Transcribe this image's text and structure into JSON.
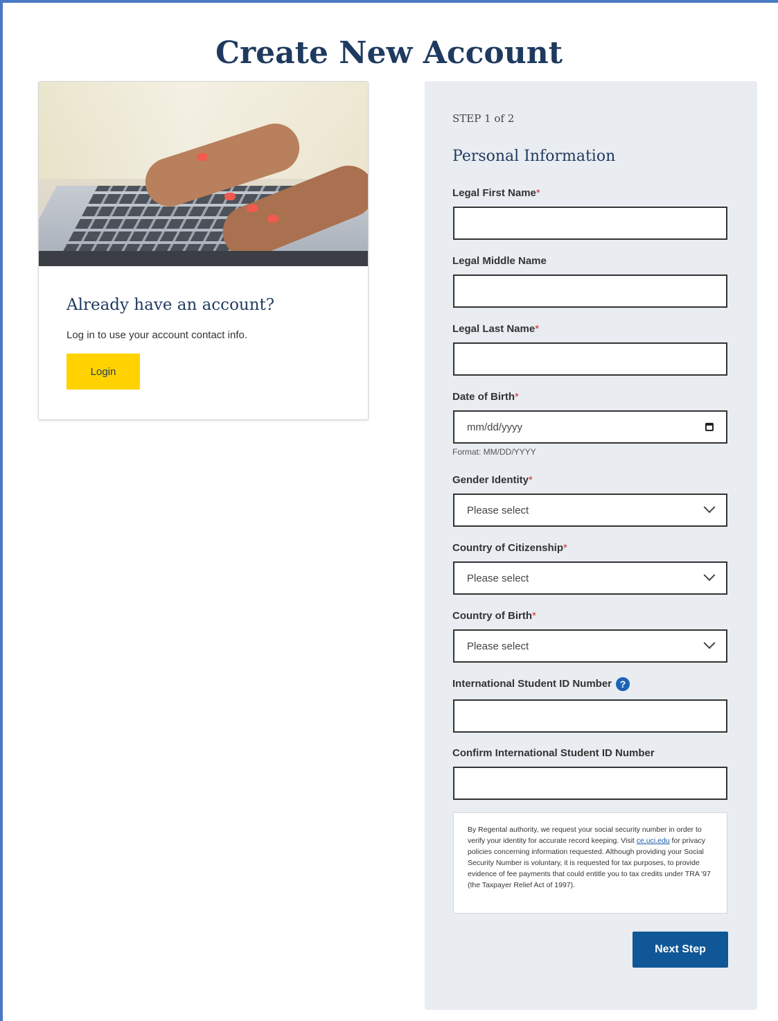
{
  "page": {
    "title": "Create New Account"
  },
  "login_card": {
    "heading": "Already have an account?",
    "text": "Log in to use your account contact info.",
    "button_label": "Login"
  },
  "form": {
    "step": "STEP 1 of 2",
    "section_title": "Personal Information",
    "fields": {
      "first_name": {
        "label": "Legal First Name",
        "required_mark": "*",
        "value": ""
      },
      "middle_name": {
        "label": "Legal Middle Name",
        "value": ""
      },
      "last_name": {
        "label": "Legal Last Name",
        "required_mark": "*",
        "value": ""
      },
      "dob": {
        "label": "Date of Birth",
        "required_mark": "*",
        "placeholder": "mm/dd/yyyy",
        "hint": "Format: MM/DD/YYYY"
      },
      "gender": {
        "label": "Gender Identity",
        "required_mark": "*",
        "selected": "Please select"
      },
      "citizenship": {
        "label": "Country of Citizenship",
        "required_mark": "*",
        "selected": "Please select"
      },
      "birth_country": {
        "label": "Country of Birth",
        "required_mark": "*",
        "selected": "Please select"
      },
      "intl_id": {
        "label": "International Student ID Number",
        "help_icon_glyph": "?",
        "value": ""
      },
      "confirm_intl_id": {
        "label": "Confirm International Student ID Number",
        "value": ""
      }
    },
    "disclaimer": {
      "before_link": "By Regental authority, we request your social security number in order to verify your identity for accurate record keeping. Visit ",
      "link_text": "ce.uci.edu",
      "after_link": " for privacy policies concerning information requested. Although providing your Social Security Number is voluntary, it is requested for tax purposes, to provide evidence of fee payments that could entitle you to tax credits under TRA '97 (the Taxpayer Relief Act of 1997)."
    },
    "next_button_label": "Next Step"
  },
  "colors": {
    "frame": "#4a78c2",
    "title": "#1f3a5f",
    "login_button": "#ffd200",
    "next_button": "#0f5796",
    "panel_bg": "#e9ecf1",
    "required": "#d0312d",
    "help_icon": "#1c64b4"
  },
  "icons": {
    "date": "calendar-icon",
    "select": "chevron-down-icon",
    "help": "question-circle-icon",
    "hero": "laptop-typing-photo"
  }
}
